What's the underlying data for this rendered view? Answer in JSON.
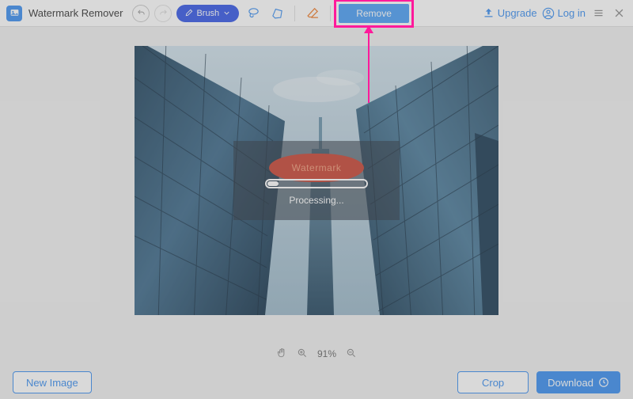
{
  "app": {
    "title": "Watermark Remover"
  },
  "toolbar": {
    "brush_label": "Brush",
    "remove_label": "Remove",
    "upgrade_label": "Upgrade",
    "login_label": "Log in"
  },
  "processing": {
    "label": "Processing...",
    "watermark_text": "Watermark",
    "progress_percent": 10
  },
  "zoom": {
    "value": "91%"
  },
  "bottom": {
    "new_image_label": "New Image",
    "crop_label": "Crop",
    "download_label": "Download"
  },
  "annotation": {
    "highlight_target": "remove-button",
    "color": "#ff1a9b"
  }
}
